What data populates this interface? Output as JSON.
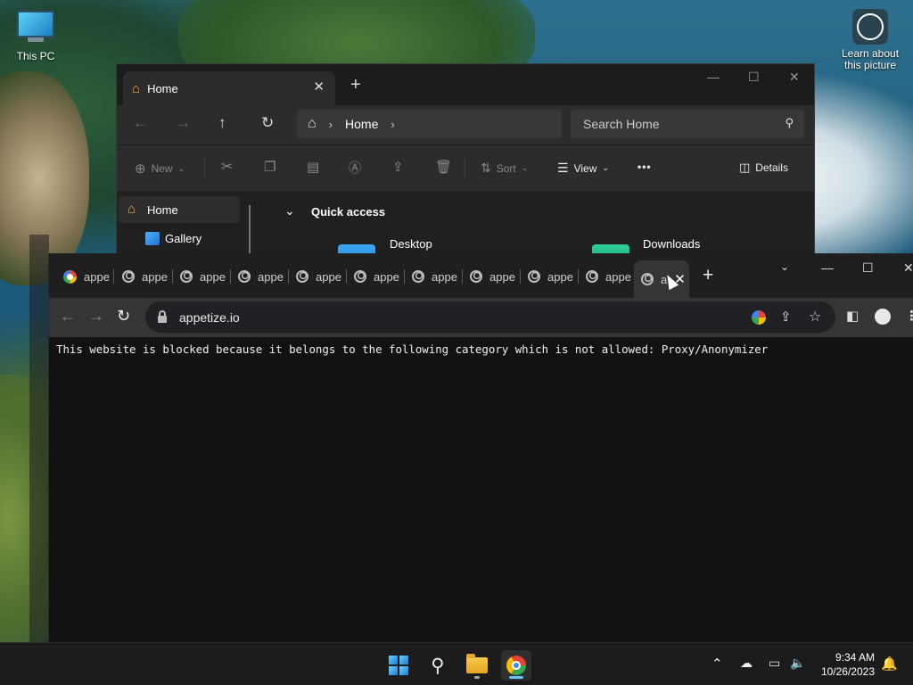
{
  "desktop": {
    "icons": [
      {
        "label": "This PC"
      },
      {
        "label": "Learn about this picture"
      }
    ]
  },
  "explorer": {
    "tab_title": "Home",
    "address": {
      "crumb": "Home"
    },
    "search_placeholder": "Search Home",
    "toolbar": {
      "new_label": "New",
      "sort_label": "Sort",
      "view_label": "View",
      "more_label": "•••",
      "details_label": "Details"
    },
    "sidebar": {
      "items": [
        {
          "label": "Home"
        },
        {
          "label": "Gallery"
        }
      ]
    },
    "quick_access": {
      "title": "Quick access",
      "items": [
        {
          "label": "Desktop"
        },
        {
          "label": "Downloads"
        }
      ]
    }
  },
  "chrome": {
    "tabs": [
      {
        "label": "appe"
      },
      {
        "label": "appe"
      },
      {
        "label": "appe"
      },
      {
        "label": "appe"
      },
      {
        "label": "appe"
      },
      {
        "label": "appe"
      },
      {
        "label": "appe"
      },
      {
        "label": "appe"
      },
      {
        "label": "appe"
      },
      {
        "label": "appe"
      },
      {
        "label": "a"
      }
    ],
    "url": "appetize.io",
    "blocked_message": "This website is blocked because it belongs to the following category which is not allowed: Proxy/Anonymizer"
  },
  "taskbar": {
    "time": "9:34 AM",
    "date": "10/26/2023"
  }
}
